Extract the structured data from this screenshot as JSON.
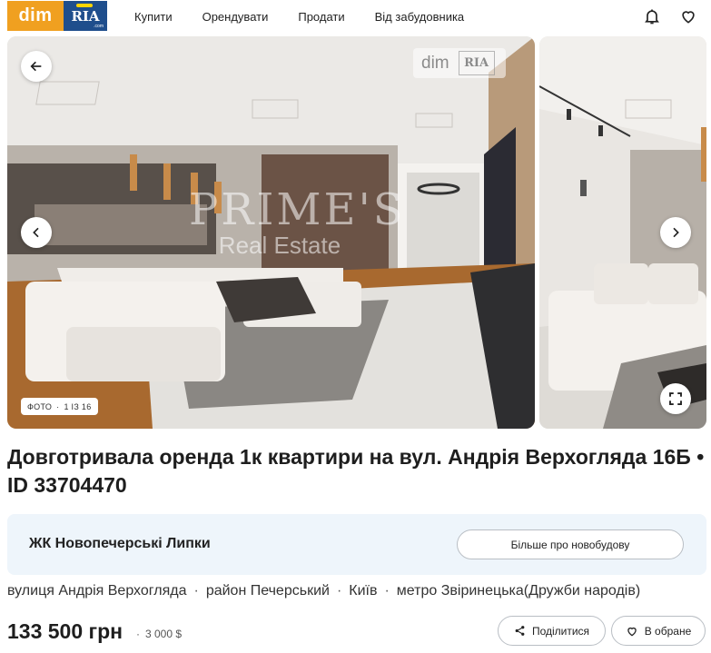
{
  "header": {
    "logo_dim": "dim",
    "logo_ria": "RIA",
    "logo_ria_domain": ".com",
    "nav": [
      "Купити",
      "Орендувати",
      "Продати",
      "Від забудовника"
    ],
    "icons": [
      "bell-icon",
      "heart-icon"
    ]
  },
  "gallery": {
    "watermark_dim": "dim",
    "watermark_ria": "RIA",
    "agency_watermark_line1": "PRIME'S",
    "agency_watermark_line2": "Real Estate",
    "counter_label": "ФОТО",
    "counter_value": "1 ІЗ 16",
    "icons": [
      "arrow-left-icon",
      "chevron-left-icon",
      "chevron-right-icon",
      "fullscreen-icon"
    ]
  },
  "listing": {
    "title": "Довготривала оренда 1к квартири на вул. Андрія Верхогляда 16Б • ID 33704470",
    "complex_name": "ЖК Новопечерські Липки",
    "complex_button": "Більше про новобудову",
    "address": [
      "вулиця Андрія Верхогляда",
      "район Печерський",
      "Київ",
      "метро Звіринецька(Дружби народів)"
    ],
    "price": "133 500 грн",
    "price_usd": "3 000 $",
    "share_label": "Поділитися",
    "favorite_label": "В обране"
  },
  "colors": {
    "logo_orange": "#f0a020",
    "logo_blue": "#1f4e8c",
    "complex_bg": "#eef5fb"
  }
}
